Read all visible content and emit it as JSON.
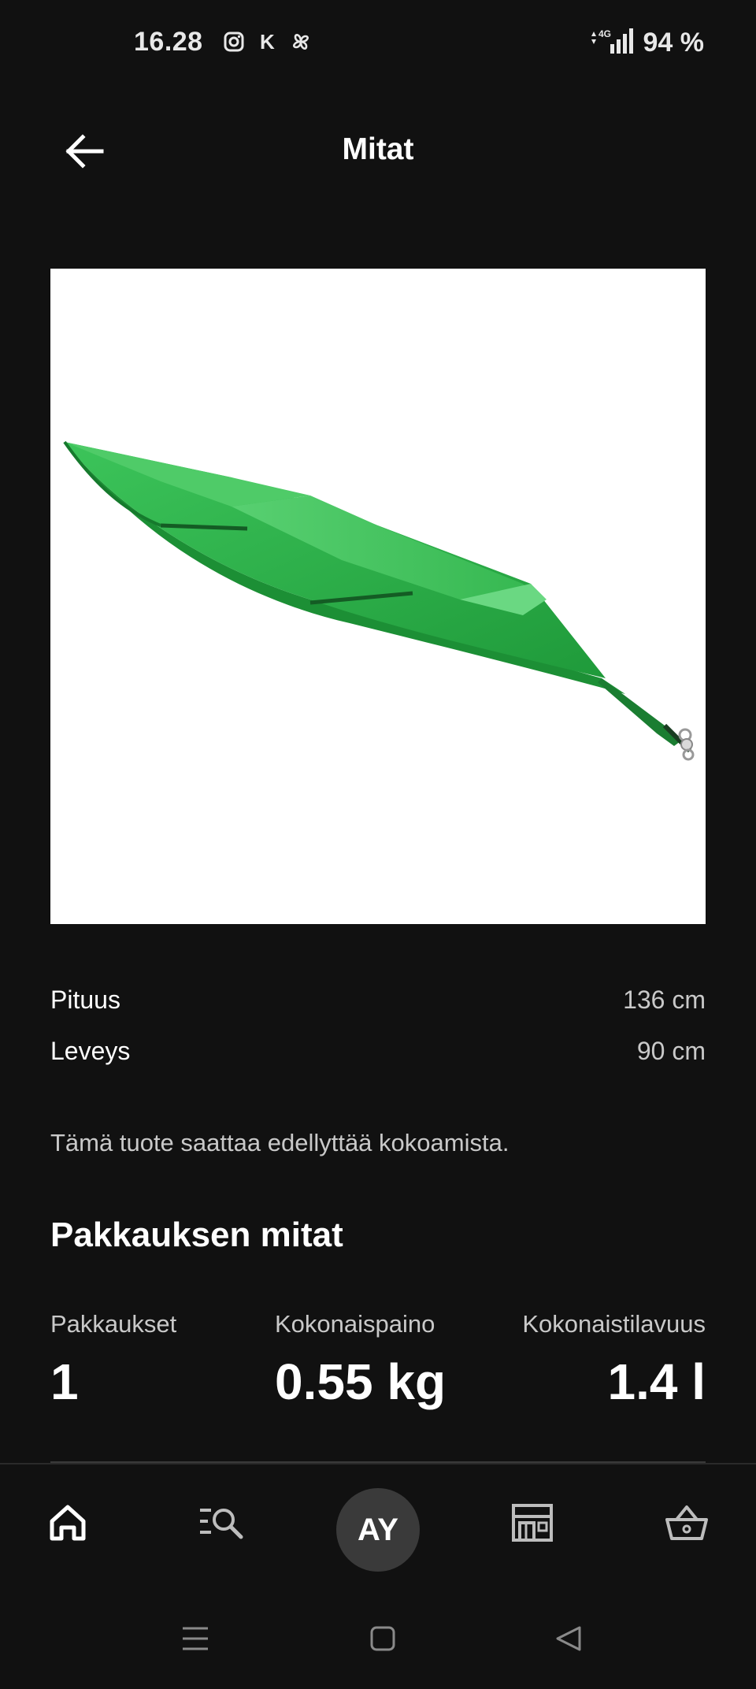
{
  "status_bar": {
    "time": "16.28",
    "carrier_letter": "K",
    "network": "4G",
    "battery": "94 %"
  },
  "header": {
    "title": "Mitat",
    "back_icon": "arrow-left-icon"
  },
  "product": {
    "image_description_icon": "green-canopy-image",
    "canopy_color": "#2fb54a"
  },
  "dimensions": [
    {
      "label": "Pituus",
      "value": "136 cm"
    },
    {
      "label": "Leveys",
      "value": "90 cm"
    }
  ],
  "assembly_note": "Tämä tuote saattaa edellyttää kokoamista.",
  "package": {
    "title": "Pakkauksen mitat",
    "columns": [
      {
        "label": "Pakkaukset",
        "value": "1"
      },
      {
        "label": "Kokonaispaino",
        "value": "0.55 kg"
      },
      {
        "label": "Kokonaistilavuus",
        "value": "1.4 l"
      }
    ]
  },
  "bottom_nav": {
    "avatar_initials": "AY",
    "items": [
      "home-icon",
      "search-list-icon",
      "avatar",
      "store-icon",
      "basket-icon"
    ]
  },
  "system_nav": [
    "recent-apps-icon",
    "home-square-icon",
    "back-triangle-icon"
  ],
  "colors": {
    "background": "#111111",
    "text_primary": "#ffffff",
    "text_secondary": "#c9c9c9",
    "avatar_bg": "#3a3a3a"
  }
}
